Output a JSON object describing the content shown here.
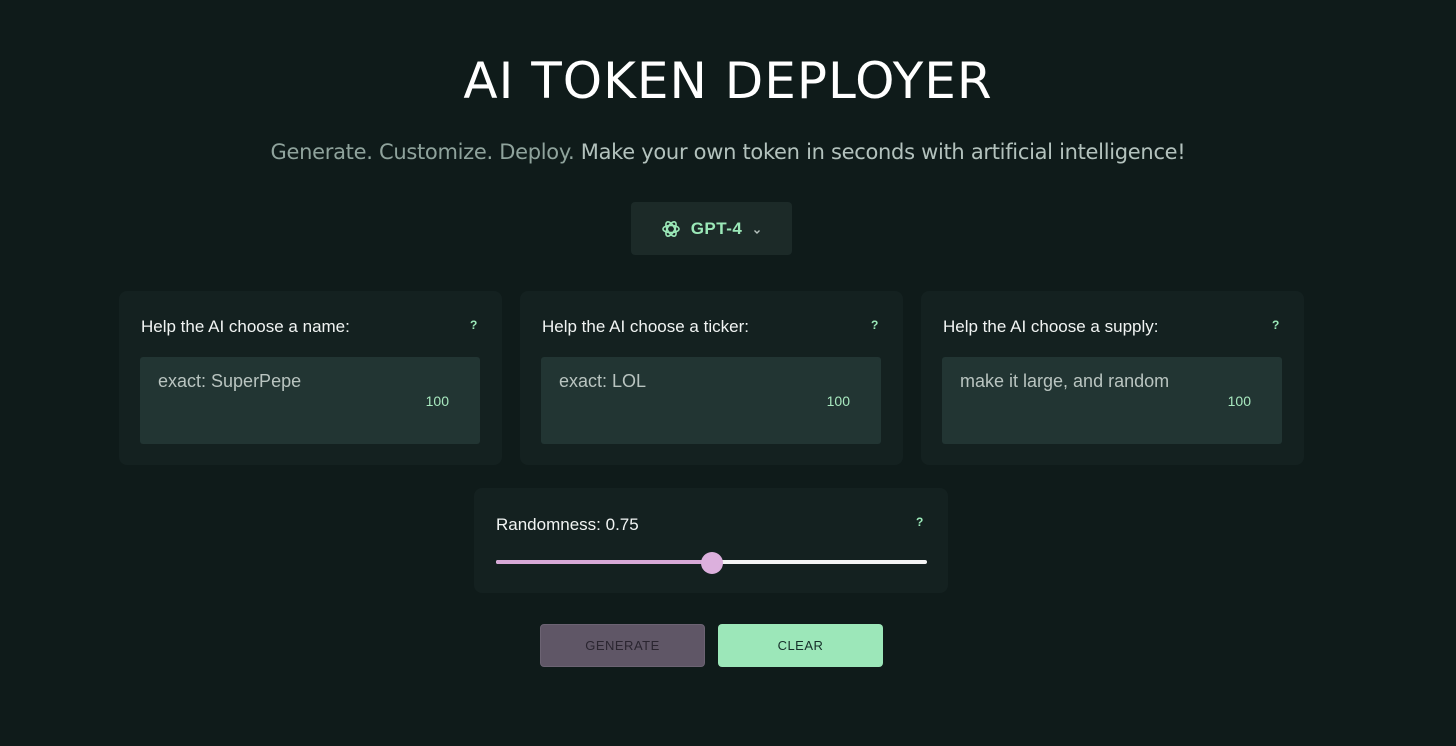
{
  "header": {
    "title": "AI TOKEN DEPLOYER",
    "subtitle_dim": "Generate. Customize. Deploy.",
    "subtitle_bright": "Make your own token in seconds with artificial intelligence!"
  },
  "model_selector": {
    "icon": "openai-logo-icon",
    "selected": "GPT-4",
    "dropdown_icon": "chevron-down-icon"
  },
  "cards": [
    {
      "label": "Help the AI choose a name:",
      "help": "?",
      "value": "exact: SuperPepe",
      "count": "100"
    },
    {
      "label": "Help the AI choose a ticker:",
      "help": "?",
      "value": "exact: LOL",
      "count": "100"
    },
    {
      "label": "Help the AI choose a supply:",
      "help": "?",
      "value": "make it large, and random",
      "count": "100"
    }
  ],
  "randomness": {
    "label": "Randomness: 0.75",
    "help": "?",
    "value": 0.75,
    "fraction": 0.5
  },
  "buttons": {
    "generate": "GENERATE",
    "clear": "CLEAR"
  },
  "colors": {
    "background": "#0f1b1a",
    "card": "#142120",
    "field": "#223533",
    "accent_green": "#9ce7b9",
    "accent_pink": "#d7a9d7",
    "generate_button": "#5f5666"
  }
}
